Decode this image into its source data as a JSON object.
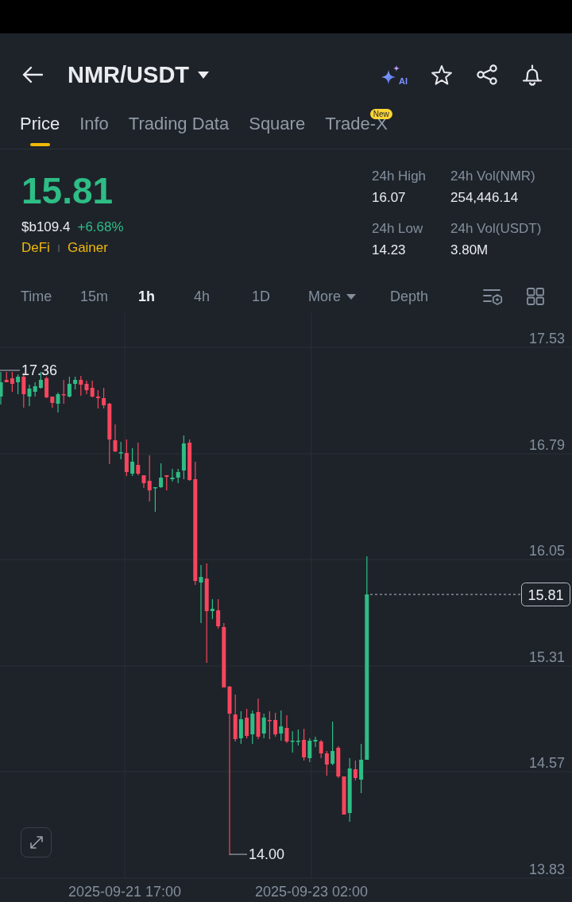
{
  "header": {
    "title": "NMR/USDT",
    "ai_label": "AI"
  },
  "tabs": [
    {
      "label": "Price",
      "selected": true
    },
    {
      "label": "Info",
      "selected": false
    },
    {
      "label": "Trading Data",
      "selected": false
    },
    {
      "label": "Square",
      "selected": false
    },
    {
      "label": "Trade-X",
      "selected": false,
      "badge": "New"
    }
  ],
  "ticker": {
    "price": "15.81",
    "fiat_price": "$b109.4",
    "change": "+6.68%",
    "tags": [
      "DeFi",
      "Gainer"
    ]
  },
  "stats": [
    {
      "label": "24h High",
      "value": "16.07"
    },
    {
      "label": "24h Vol(NMR)",
      "value": "254,446.14"
    },
    {
      "label": "24h Low",
      "value": "14.23"
    },
    {
      "label": "24h Vol(USDT)",
      "value": "3.80M"
    }
  ],
  "intervals": [
    {
      "label": "Time",
      "kind": "interval",
      "selected": false
    },
    {
      "label": "15m",
      "kind": "interval",
      "selected": false
    },
    {
      "label": "1h",
      "kind": "interval",
      "selected": true
    },
    {
      "label": "4h",
      "kind": "interval",
      "selected": false
    },
    {
      "label": "1D",
      "kind": "interval",
      "selected": false
    },
    {
      "label": "More",
      "kind": "menu",
      "selected": false
    },
    {
      "label": "Depth",
      "kind": "view",
      "selected": false
    }
  ],
  "chart": {
    "price_ticks": [
      "17.53",
      "16.79",
      "16.05",
      "15.31",
      "14.57",
      "13.83"
    ],
    "time_ticks": [
      "2025-09-21 17:00",
      "2025-09-23 02:00"
    ],
    "high_marker": "17.36",
    "low_marker": "14.00",
    "last_price": "15.81"
  }
}
